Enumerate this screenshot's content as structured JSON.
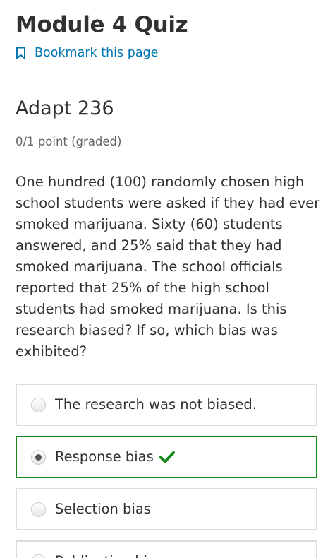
{
  "header": {
    "title": "Module 4 Quiz",
    "bookmark_label": "Bookmark this page"
  },
  "problem": {
    "title": "Adapt 236",
    "points": "0/1 point (graded)",
    "question": "One hundred (100) randomly chosen high school students were asked if they had ever smoked marijuana. Sixty (60) students answered, and 25% said that they had smoked marijuana. The school officials reported that 25% of the high school students had smoked marijuana. Is this research biased? If so, which bias was exhibited?",
    "choices": [
      {
        "label": "The research was not biased.",
        "selected": false
      },
      {
        "label": "Response bias",
        "selected": true,
        "status": "correct"
      },
      {
        "label": "Selection bias",
        "selected": false
      },
      {
        "label": "Publication bias",
        "selected": false
      }
    ]
  },
  "colors": {
    "link": "#0075b4",
    "correct": "#178a1c",
    "border": "#dcdcdc",
    "text": "#313131"
  },
  "icons": {
    "bookmark": "bookmark-icon",
    "correct": "checkmark-icon"
  }
}
